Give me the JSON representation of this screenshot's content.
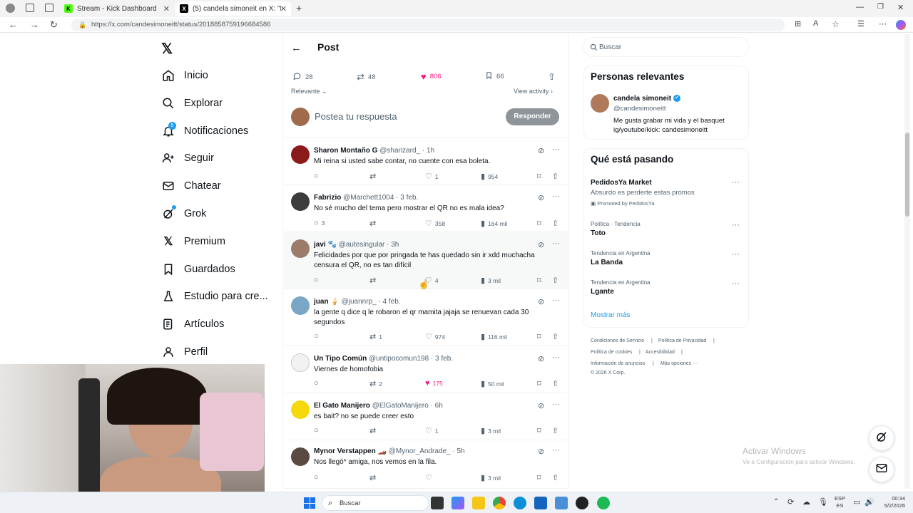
{
  "browser": {
    "tabs": [
      {
        "title": "Stream - Kick Dashboard"
      },
      {
        "title": "(5) candela simoneit en X: \"Estab"
      }
    ],
    "url": "https://x.com/candesimoneitt/status/2018858759196684586"
  },
  "nav": {
    "items": [
      {
        "label": "Inicio",
        "icon": "home-icon"
      },
      {
        "label": "Explorar",
        "icon": "search-icon"
      },
      {
        "label": "Notificaciones",
        "icon": "bell-icon",
        "badge": "5"
      },
      {
        "label": "Seguir",
        "icon": "person-add-icon"
      },
      {
        "label": "Chatear",
        "icon": "mail-icon"
      },
      {
        "label": "Grok",
        "icon": "grok-icon"
      },
      {
        "label": "Premium",
        "icon": "x-logo-icon"
      },
      {
        "label": "Guardados",
        "icon": "bookmark-icon"
      },
      {
        "label": "Estudio para cre...",
        "icon": "flask-icon"
      },
      {
        "label": "Artículos",
        "icon": "article-icon"
      },
      {
        "label": "Perfil",
        "icon": "person-icon"
      }
    ]
  },
  "post": {
    "header": "Post",
    "stats": {
      "replies": "28",
      "reposts": "48",
      "likes": "806",
      "views": "66"
    },
    "sort_label": "Relevante",
    "view_activity": "View activity",
    "reply_placeholder": "Postea tu respuesta",
    "reply_button": "Responder"
  },
  "replies": [
    {
      "name": "Sharon Montaño G",
      "handle": "@sharizard_ · 1h",
      "text": "Mi reina si usted sabe contar, no cuente con esa boleta.",
      "replies": "",
      "reposts": "",
      "likes": "1",
      "views": "954",
      "liked": false
    },
    {
      "name": "Fabrizio",
      "handle": "@Marchett1004 · 3 feb.",
      "text": "No sé mucho del tema pero mostrar el QR no es mala idea?",
      "replies": "3",
      "reposts": "",
      "likes": "358",
      "views": "164 mil",
      "liked": false
    },
    {
      "name": "javi 🐾",
      "handle": "@autesingular · 3h",
      "text": "Felicidades por que por pringada te has quedado sin ir xdd muchacha censura el QR, no es tan difícil",
      "replies": "",
      "reposts": "",
      "likes": "4",
      "views": "3 mil",
      "liked": false
    },
    {
      "name": "juan 🍦",
      "handle": "@juannrp_ · 4 feb.",
      "text": "la gente q dice q le robaron el qr mamita jajaja se renuevan cada 30 segundos",
      "replies": "",
      "reposts": "1",
      "likes": "974",
      "views": "116 mil",
      "liked": false
    },
    {
      "name": "Un Tipo Común",
      "handle": "@untipocomun198 · 3 feb.",
      "text": "Viernes de homofobia",
      "replies": "",
      "reposts": "2",
      "likes": "175",
      "views": "50 mil",
      "liked": true
    },
    {
      "name": "El Gato Manijero",
      "handle": "@ElGatoManijero · 6h",
      "text": "es bait? no se puede creer esto",
      "replies": "",
      "reposts": "",
      "likes": "1",
      "views": "3 mil",
      "liked": false
    },
    {
      "name": "Mynor Verstappen 🏎️",
      "handle": "@Mynor_Andrade_ · 5h",
      "text": "Nos llegó* amiga, nos vemos en la fila.",
      "replies": "",
      "reposts": "",
      "likes": "",
      "views": "3 mil",
      "liked": false
    }
  ],
  "right": {
    "search_placeholder": "Buscar",
    "relevant_title": "Personas relevantes",
    "person": {
      "name": "candela simoneit",
      "handle": "@candesimoneitt",
      "bio": "Me gusta grabar mi vida y el basquet ig/youtube/kick: candesimoneitt"
    },
    "happening_title": "Qué está pasando",
    "promo": {
      "name": "PedidosYa Market",
      "text": "Absurdo es perderte estas promos",
      "promoted": "Promoted by PedidosYa"
    },
    "trends": [
      {
        "context": "Política · Tendencia",
        "name": "Toto"
      },
      {
        "context": "Tendencia en Argentina",
        "name": "La Banda"
      },
      {
        "context": "Tendencia en Argentina",
        "name": "Lgante"
      }
    ],
    "show_more": "Mostrar más",
    "footer": [
      "Condiciones de Servicio",
      "Política de Privacidad",
      "Política de cookies",
      "Accesibilidad",
      "Información de anuncios",
      "Más opciones ···",
      "© 2026 X Corp."
    ]
  },
  "windows": {
    "activate_title": "Activar Windows",
    "activate_text": "Ve a Configuración para activar Windows.",
    "search": "Buscar",
    "lang1": "ESP",
    "lang2": "ES",
    "time": "00:34",
    "date": "5/2/2026"
  },
  "colors": {
    "accent": "#1d9bf0",
    "like": "#f91880",
    "kick": "#53fc18"
  }
}
